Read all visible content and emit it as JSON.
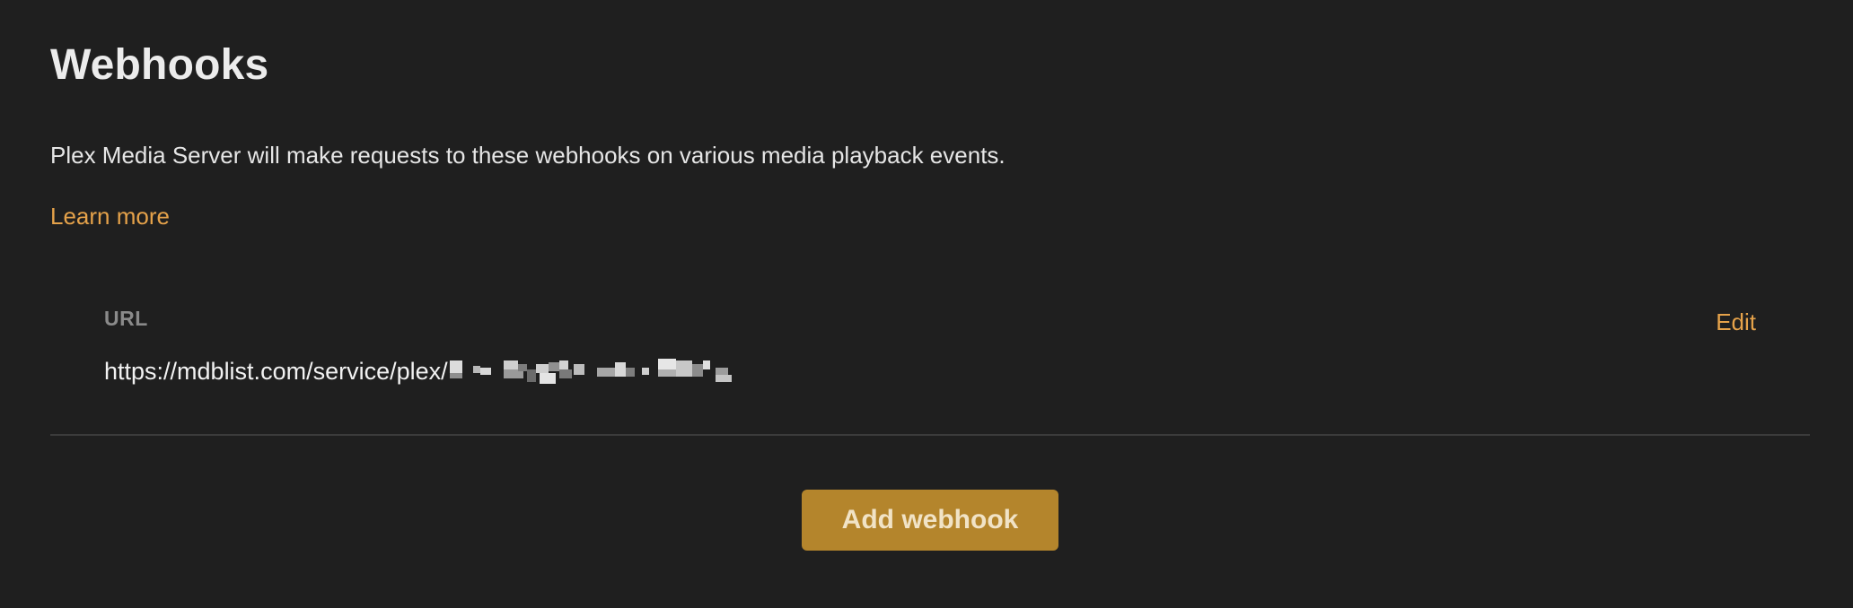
{
  "header": {
    "title": "Webhooks"
  },
  "intro": {
    "description": "Plex Media Server will make requests to these webhooks on various media playback events.",
    "learn_more_label": "Learn more"
  },
  "webhooks": [
    {
      "field_label": "URL",
      "url": "https://mdblist.com/service/plex/",
      "url_redacted": true,
      "edit_label": "Edit"
    }
  ],
  "actions": {
    "add_webhook_label": "Add webhook"
  },
  "colors": {
    "background": "#1f1f1f",
    "accent_link": "#e5a24a",
    "button_background": "#b4852c",
    "divider": "#3b3b3b"
  }
}
